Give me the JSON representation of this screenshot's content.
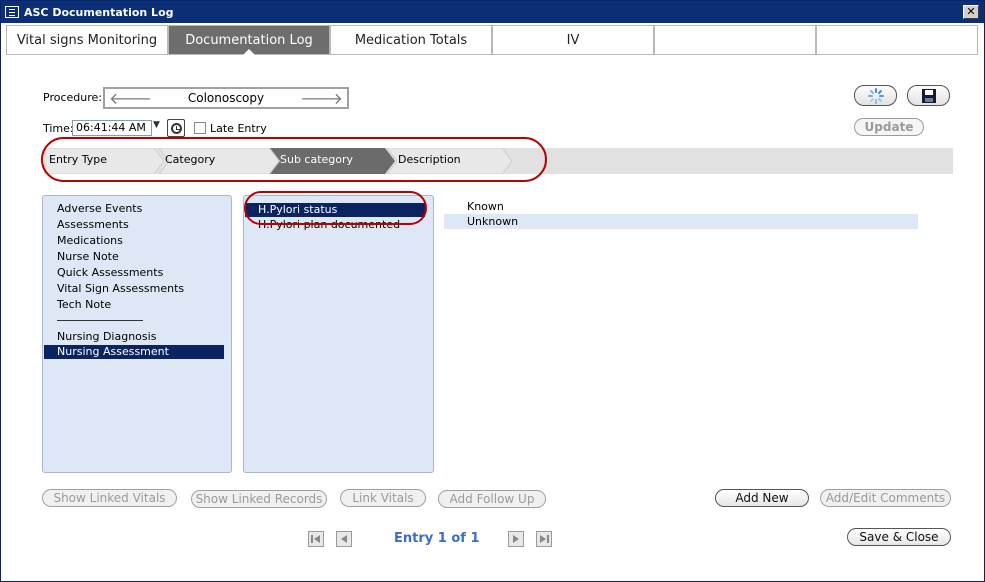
{
  "window": {
    "title": "ASC Documentation Log",
    "close_label": "✕"
  },
  "tabs": [
    {
      "label": "Vital signs Monitoring"
    },
    {
      "label": "Documentation Log"
    },
    {
      "label": "Medication Totals"
    },
    {
      "label": "IV"
    },
    {
      "label": ""
    },
    {
      "label": ""
    }
  ],
  "form": {
    "procedure_label": "Procedure:",
    "procedure_value": "Colonoscopy",
    "time_label": "Time:",
    "time_value": "06:41:44 AM",
    "late_entry_label": "Late Entry",
    "update_label": "Update"
  },
  "breadcrumb": [
    {
      "label": "Entry Type"
    },
    {
      "label": "Category"
    },
    {
      "label": "Sub category"
    },
    {
      "label": "Description"
    }
  ],
  "entry_types": [
    "Adverse Events",
    "Assessments",
    "Medications",
    "Nurse Note",
    "Quick Assessments",
    "Vital Sign Assessments",
    "Tech Note",
    "Nursing Diagnosis",
    "Nursing Assessment"
  ],
  "subcategories": [
    "H.Pylori status",
    "H.Pylori plan documented"
  ],
  "descriptions": [
    "Known",
    "Unknown"
  ],
  "actions": {
    "show_linked_vitals": "Show Linked Vitals",
    "show_linked_records": "Show Linked Records",
    "link_vitals": "Link Vitals",
    "add_follow_up": "Add Follow Up",
    "add_new": "Add New",
    "add_edit_comments": "Add/Edit Comments",
    "save_close": "Save & Close"
  },
  "pager": {
    "text": "Entry 1 of 1"
  },
  "colors": {
    "titlebar": "#0a2f77",
    "selected": "#0a2462",
    "panel": "#dde7f6",
    "annotation": "#b00000",
    "link": "#3b6cc9"
  }
}
